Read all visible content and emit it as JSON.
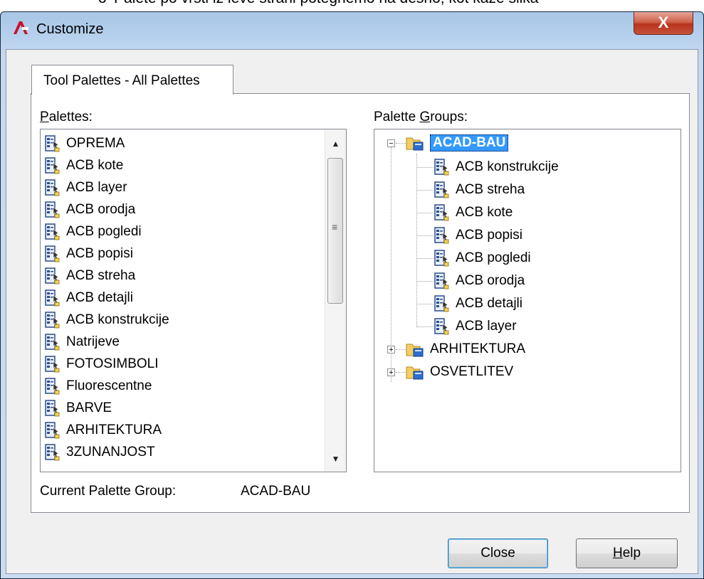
{
  "doc_line": {
    "bullet": "o",
    "text": "Palete po vrsti iz leve strani potegnemo na desno, kot kaže slika"
  },
  "window": {
    "title": "Customize",
    "close_glyph": "X"
  },
  "tab": {
    "label": "Tool Palettes - All Palettes"
  },
  "palettes": {
    "label_prefix": "P",
    "label_rest": "alettes:",
    "items": [
      "OPREMA",
      "ACB kote",
      "ACB layer",
      "ACB orodja",
      "ACB pogledi",
      "ACB popisi",
      "ACB streha",
      "ACB detajli",
      "ACB konstrukcije",
      "Natrijeve",
      "FOTOSIMBOLI",
      "Fluorescentne",
      "BARVE",
      "ARHITEKTURA",
      "3ZUNANJOST"
    ]
  },
  "palette_groups": {
    "label_prefix": "Palette ",
    "label_u": "G",
    "label_rest": "roups:",
    "root": {
      "label": "ACAD-BAU",
      "expander": "−",
      "children": [
        "ACB konstrukcije",
        "ACB streha",
        "ACB kote",
        "ACB popisi",
        "ACB pogledi",
        "ACB orodja",
        "ACB detajli",
        "ACB layer"
      ]
    },
    "others": [
      {
        "label": "ARHITEKTURA",
        "expander": "+"
      },
      {
        "label": "OSVETLITEV",
        "expander": "+"
      }
    ]
  },
  "current_group": {
    "label": "Current Palette Group:",
    "value": "ACAD-BAU"
  },
  "buttons": {
    "close": "Close",
    "help_u": "H",
    "help_rest": "elp"
  },
  "icons": {
    "palette": "tool-palette-icon",
    "folder": "palette-group-folder-icon",
    "app": "autocad-icon"
  }
}
